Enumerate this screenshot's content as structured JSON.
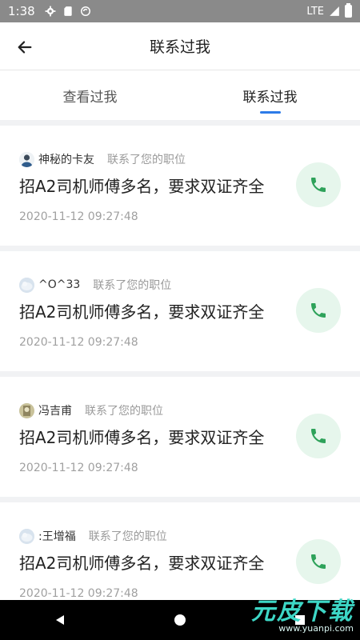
{
  "status_bar": {
    "time": "1:38",
    "network": "LTE"
  },
  "header": {
    "title": "联系过我"
  },
  "tabs": [
    {
      "label": "查看过我",
      "active": false
    },
    {
      "label": "联系过我",
      "active": true
    }
  ],
  "items": [
    {
      "name": "神秘的卡友",
      "action": "联系了您的职位",
      "job": "招A2司机师傅多名，要求双证齐全",
      "time": "2020-11-12 09:27:48"
    },
    {
      "name": "^O^33",
      "action": "联系了您的职位",
      "job": "招A2司机师傅多名，要求双证齐全",
      "time": "2020-11-12 09:27:48"
    },
    {
      "name": "冯吉甫",
      "action": "联系了您的职位",
      "job": "招A2司机师傅多名，要求双证齐全",
      "time": "2020-11-12 09:27:48"
    },
    {
      "name": ":王增福",
      "action": "联系了您的职位",
      "job": "招A2司机师傅多名，要求双证齐全",
      "time": "2020-11-12 09:27:48"
    }
  ],
  "watermark": {
    "main": "元皮下载",
    "sub": "www.yuanpi.com"
  },
  "colors": {
    "accent": "#2d7be8",
    "call_green": "#2ea25a",
    "call_bg": "#e6f6ec"
  },
  "icons": [
    "back-arrow-icon",
    "phone-icon",
    "settings-icon",
    "sd-card-icon",
    "sync-icon",
    "signal-icon",
    "battery-icon"
  ]
}
